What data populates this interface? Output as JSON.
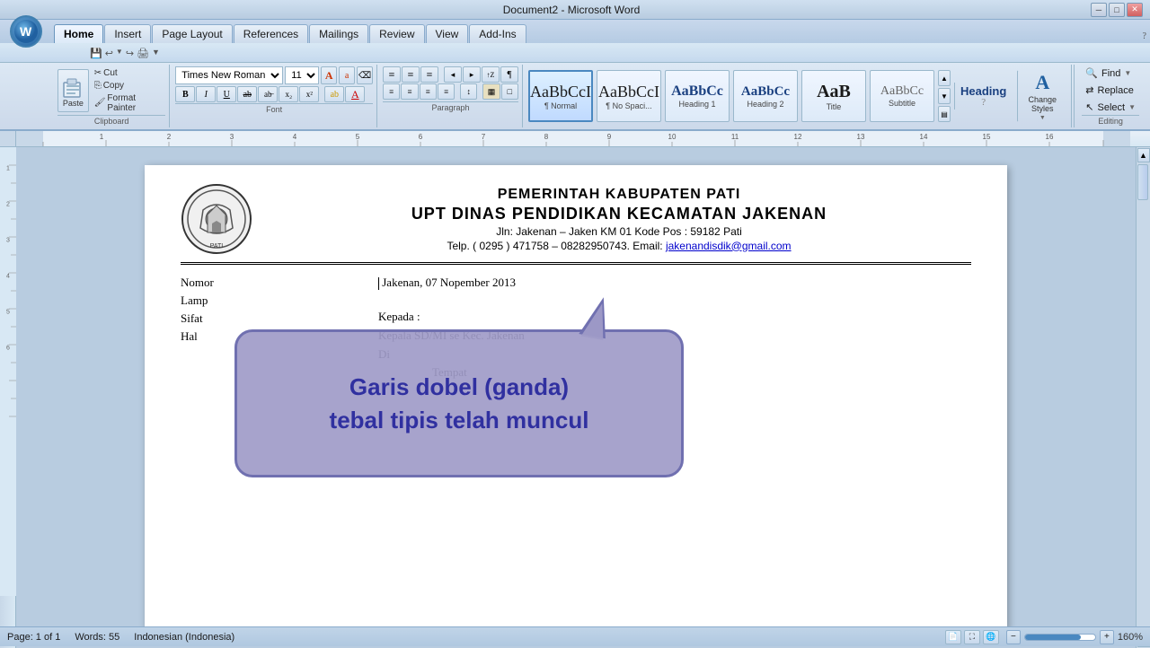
{
  "titlebar": {
    "title": "Document2 - Microsoft Word",
    "min_btn": "─",
    "max_btn": "□",
    "close_btn": "✕"
  },
  "tabs": [
    {
      "label": "Home",
      "active": true
    },
    {
      "label": "Insert",
      "active": false
    },
    {
      "label": "Page Layout",
      "active": false
    },
    {
      "label": "References",
      "active": false
    },
    {
      "label": "Mailings",
      "active": false
    },
    {
      "label": "Review",
      "active": false
    },
    {
      "label": "View",
      "active": false
    },
    {
      "label": "Add-Ins",
      "active": false
    }
  ],
  "ribbon": {
    "clipboard": {
      "label": "Clipboard",
      "paste_label": "Paste",
      "cut_label": "Cut",
      "copy_label": "Copy",
      "format_painter_label": "Format Painter"
    },
    "font": {
      "label": "Font",
      "font_name": "Times New Roman",
      "font_size": "11",
      "bold": "B",
      "italic": "I",
      "underline": "U",
      "strikethrough": "ab",
      "subscript": "x₂",
      "superscript": "x²",
      "grow": "A",
      "shrink": "a",
      "clear_formatting": "A",
      "highlight": "ab",
      "font_color": "A"
    },
    "paragraph": {
      "label": "Paragraph"
    },
    "styles": {
      "label": "Styles",
      "normal_label": "¶ Normal",
      "no_spacing_label": "¶ No Spaci...",
      "heading1_label": "Heading 1",
      "heading2_label": "Heading 2",
      "title_label": "Title",
      "subtitle_label": "Subtitle"
    },
    "change_styles": {
      "label": "Change\nStyles",
      "icon": "A"
    },
    "heading_question": {
      "label": "Heading ?",
      "question": "?"
    },
    "editing": {
      "label": "Editing",
      "find_label": "Find",
      "replace_label": "Replace",
      "select_label": "Select"
    }
  },
  "document": {
    "letterhead": {
      "title1": "PEMERINTAH KABUPATEN PATI",
      "title2": "UPT  DINAS PENDIDIKAN KECAMATAN JAKENAN",
      "address": "Jln:  Jakenan – Jaken KM 01  Kode Pos : 59182 Pati",
      "contact": "Telp. ( 0295 ) 471758 – 08282950743. Email: jakenandisdik@gmail.com",
      "email": "jakenandisdik@gmail.com"
    },
    "letter": {
      "nomor_label": "Nomor",
      "lamp_label": "Lamp",
      "sifat_label": "Sifat",
      "hal_label": "Hal",
      "date": "Jakenan, 07 Nopember  2013",
      "kepada_label": "Kepada :",
      "recipient1": "Kepala SD/MI se Kec. Jakenan",
      "recipient2": "Di",
      "recipient3": "Tempat"
    }
  },
  "tooltip": {
    "line1": "Garis dobel (ganda)",
    "line2": "tebal tipis telah muncul"
  },
  "statusbar": {
    "page": "Page: 1 of 1",
    "words": "Words: 55",
    "language": "Indonesian (Indonesia)",
    "zoom": "160%"
  }
}
